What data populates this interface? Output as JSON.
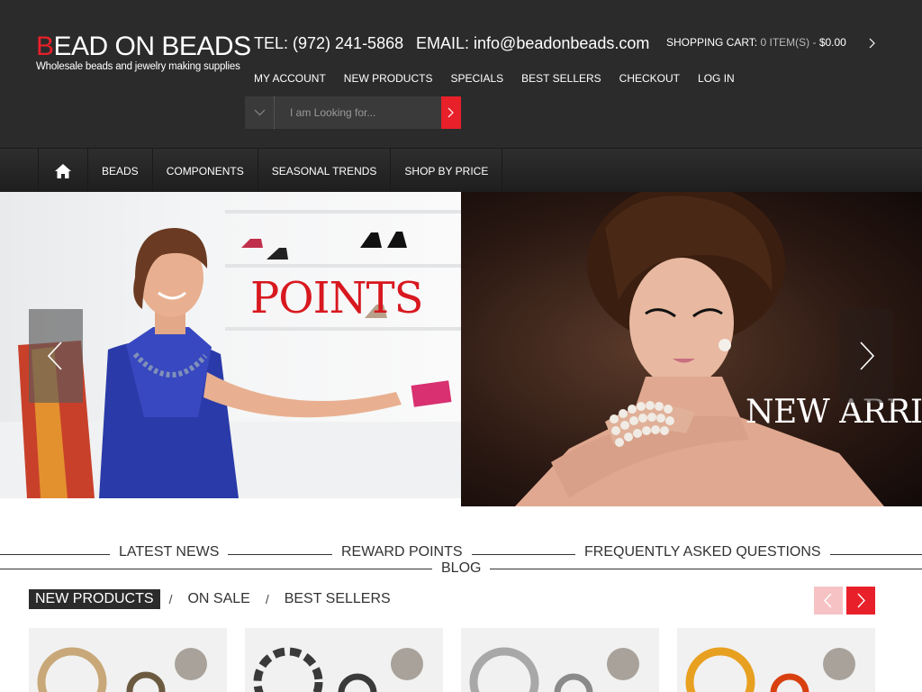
{
  "brand": {
    "logo_b": "B",
    "logo_rest": "EAD ON BEADS",
    "logo_tagline": "Wholesale beads and jewelry making supplies"
  },
  "contact": {
    "tel": "TEL: (972) 241-5868",
    "email": "EMAIL: info@beadonbeads.com"
  },
  "cart": {
    "label": "SHOPPING CART:",
    "items": "0 ITEM(S) -",
    "total": "$0.00"
  },
  "top_nav": [
    "MY ACCOUNT",
    "NEW PRODUCTS",
    "SPECIALS",
    "BEST SELLERS",
    "CHECKOUT",
    "LOG IN"
  ],
  "search": {
    "placeholder": "I am Looking for..."
  },
  "main_menu": [
    "BEADS",
    "COMPONENTS",
    "SEASONAL TRENDS",
    "SHOP BY PRICE"
  ],
  "banners": {
    "left_title": "POINTS",
    "right_title": "NEW ARRIVALS"
  },
  "info_links": [
    "LATEST NEWS",
    "REWARD POINTS",
    "FREQUENTLY ASKED QUESTIONS",
    "BLOG"
  ],
  "product_tabs": [
    "NEW PRODUCTS",
    "ON SALE",
    "BEST SELLERS"
  ],
  "product_tab_separator": "/",
  "products": [
    {
      "ring_color": "#c8a878",
      "accent": "#6b5a40"
    },
    {
      "ring_color": "#3a3a3a",
      "accent": "#d8d8d8"
    },
    {
      "ring_color": "#a8a8a8",
      "accent": "#e0e0e0"
    },
    {
      "ring_color": "#e8a020",
      "accent": "#d84010"
    }
  ],
  "colors": {
    "accent_red": "#e8202a",
    "header_bg": "#2b2b2b"
  },
  "icons": [
    "home-icon",
    "chevron-right-icon",
    "chevron-down-icon",
    "arrow-left-icon",
    "arrow-right-icon"
  ]
}
